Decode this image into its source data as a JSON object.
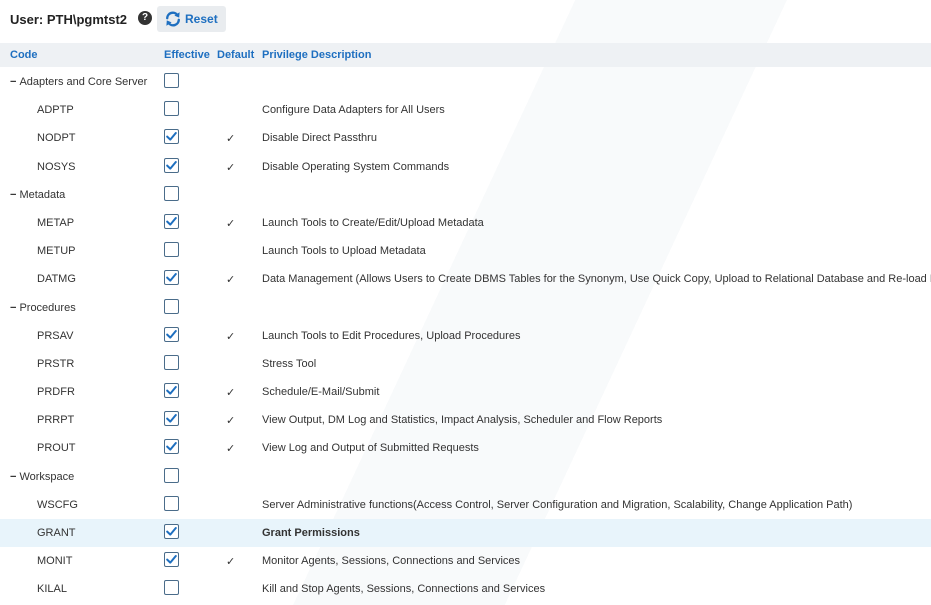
{
  "header": {
    "user_label": "User: PTH\\pgmtst2",
    "help_glyph": "?",
    "reset_label": "Reset"
  },
  "columns": {
    "code": "Code",
    "effective": "Effective",
    "default": "Default",
    "description": "Privilege Description"
  },
  "colors": {
    "accent": "#1e6fc0",
    "selected_row": "#e8f4fb",
    "header_bg": "#eef1f4"
  },
  "rows": [
    {
      "type": "group",
      "label": "Adapters and Core Server",
      "expand_glyph": "−",
      "effective": false
    },
    {
      "type": "item",
      "code": "ADPTP",
      "effective": false,
      "default": "",
      "description": "Configure Data Adapters for All Users"
    },
    {
      "type": "item",
      "code": "NODPT",
      "effective": true,
      "default": "✓",
      "description": "Disable Direct Passthru"
    },
    {
      "type": "item",
      "code": "NOSYS",
      "effective": true,
      "default": "✓",
      "description": "Disable Operating System Commands"
    },
    {
      "type": "group",
      "label": "Metadata",
      "expand_glyph": "−",
      "effective": false
    },
    {
      "type": "item",
      "code": "METAP",
      "effective": true,
      "default": "✓",
      "description": "Launch Tools to Create/Edit/Upload Metadata"
    },
    {
      "type": "item",
      "code": "METUP",
      "effective": false,
      "default": "",
      "description": "Launch Tools to Upload Metadata"
    },
    {
      "type": "item",
      "code": "DATMG",
      "effective": true,
      "default": "✓",
      "description": "Data Management (Allows Users to Create DBMS Tables for the Synonym, Use Quick Copy, Upload to Relational Database and Re-load Data)"
    },
    {
      "type": "group",
      "label": "Procedures",
      "expand_glyph": "−",
      "effective": false
    },
    {
      "type": "item",
      "code": "PRSAV",
      "effective": true,
      "default": "✓",
      "description": "Launch Tools to Edit Procedures, Upload Procedures"
    },
    {
      "type": "item",
      "code": "PRSTR",
      "effective": false,
      "default": "",
      "description": "Stress Tool"
    },
    {
      "type": "item",
      "code": "PRDFR",
      "effective": true,
      "default": "✓",
      "description": "Schedule/E-Mail/Submit"
    },
    {
      "type": "item",
      "code": "PRRPT",
      "effective": true,
      "default": "✓",
      "description": "View Output, DM Log and Statistics, Impact Analysis, Scheduler and Flow Reports"
    },
    {
      "type": "item",
      "code": "PROUT",
      "effective": true,
      "default": "✓",
      "description": "View Log and Output of Submitted Requests"
    },
    {
      "type": "group",
      "label": "Workspace",
      "expand_glyph": "−",
      "effective": false
    },
    {
      "type": "item",
      "code": "WSCFG",
      "effective": false,
      "default": "",
      "description": "Server Administrative functions(Access Control, Server Configuration and Migration, Scalability, Change Application Path)"
    },
    {
      "type": "item",
      "code": "GRANT",
      "effective": true,
      "default": "",
      "description": "Grant Permissions",
      "selected": true
    },
    {
      "type": "item",
      "code": "MONIT",
      "effective": true,
      "default": "✓",
      "description": "Monitor Agents, Sessions, Connections and Services"
    },
    {
      "type": "item",
      "code": "KILAL",
      "effective": false,
      "default": "",
      "description": "Kill and Stop Agents, Sessions, Connections and Services"
    }
  ]
}
